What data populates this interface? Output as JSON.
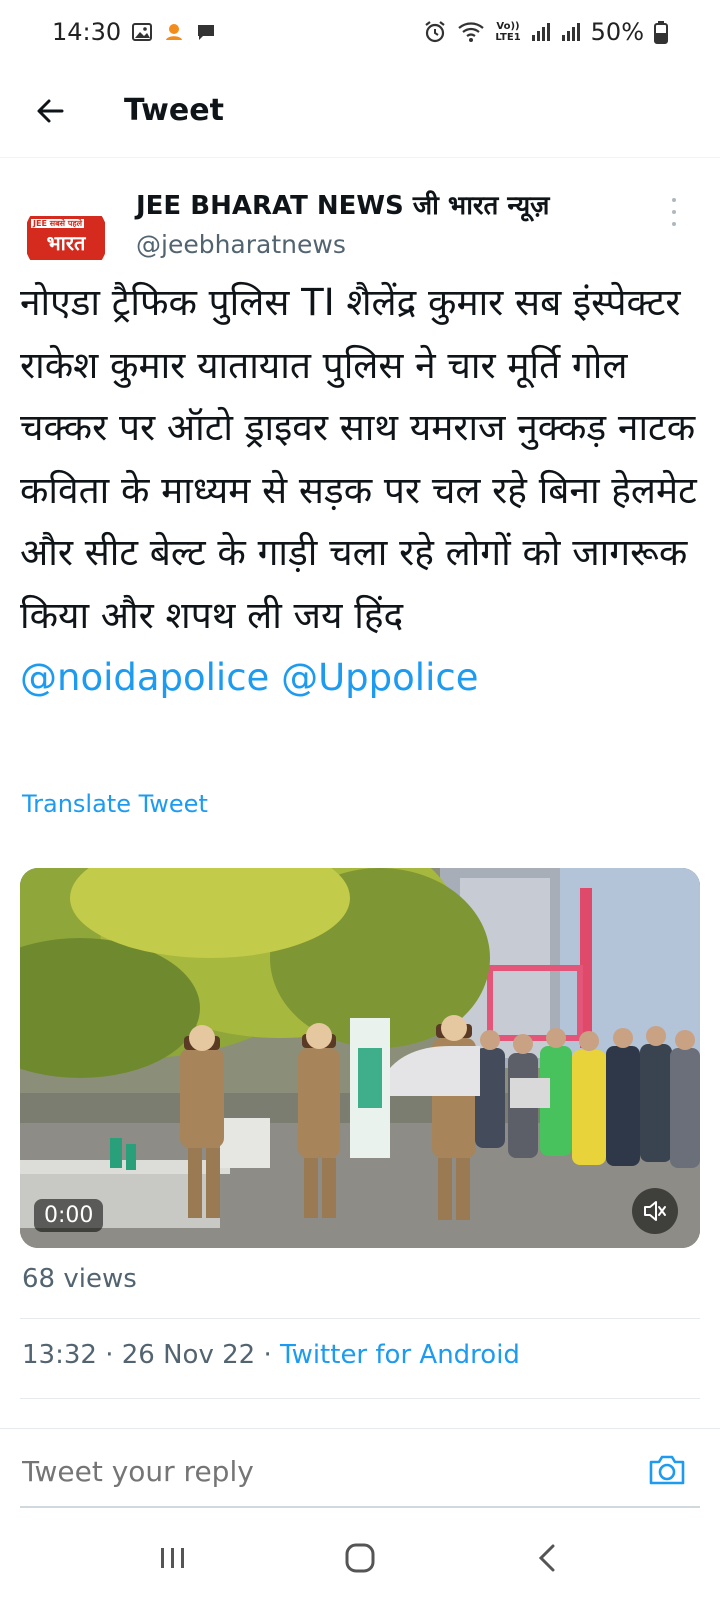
{
  "status_bar": {
    "time": "14:30",
    "battery": "50%",
    "lte_label_top": "Vo))",
    "lte_label_bottom": "LTE1"
  },
  "header": {
    "title": "Tweet"
  },
  "tweet": {
    "author_name": "JEE BHARAT NEWS जी भारत न्यूज़",
    "handle": "@jeebharatnews",
    "avatar_logo_top": "JEE सबसे पहले",
    "avatar_logo_main": "भारत",
    "text": "नोएडा ट्रैफिक पुलिस TI शैलेंद्र कुमार सब इंस्पेक्टर राकेश कुमार यातायात पुलिस ने चार मूर्ति गोल चक्कर पर ऑटो ड्राइवर साथ यमराज नुक्कड़ नाटक कविता  के माध्यम से सड़क पर चल रहे बिना हेलमेट और सीट बेल्ट के गाड़ी चला रहे लोगों को जागरूक किया और शपथ ली जय हिंद",
    "mention_1": "@noidapolice",
    "mention_2": "@Uppolice",
    "translate_label": "Translate Tweet",
    "video_time": "0:00",
    "views": "68 views",
    "time": "13:32",
    "date": "26 Nov 22",
    "separator": " · ",
    "source": "Twitter for Android"
  },
  "reply": {
    "placeholder": "Tweet your reply"
  },
  "colors": {
    "accent": "#1d9bf0",
    "secondary_text": "#536471",
    "logo_red": "#d52b1e"
  },
  "icons": {
    "back": "arrow-left-icon",
    "more": "more-vertical-icon",
    "mute": "volume-mute-icon",
    "camera": "camera-icon",
    "nav_recents": "recents-icon",
    "nav_home": "home-icon",
    "nav_back": "back-chevron-icon"
  }
}
